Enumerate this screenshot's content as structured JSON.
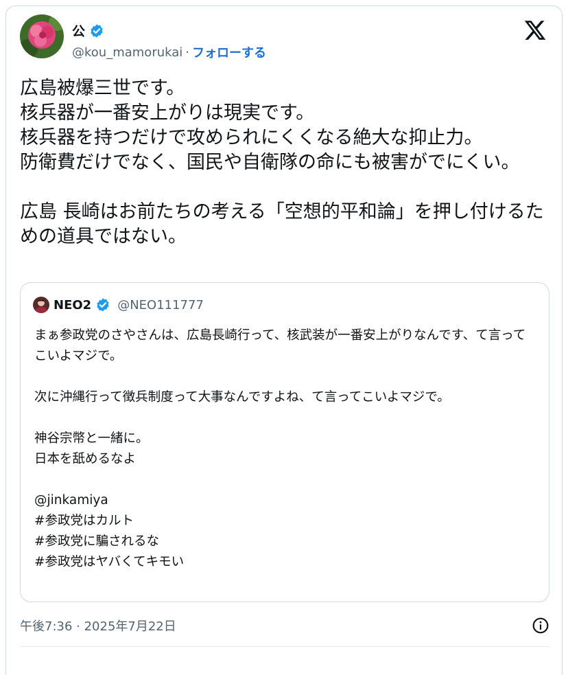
{
  "author": {
    "display_name": "公",
    "handle": "@kou_mamorukai",
    "separator": "·",
    "follow_label": "フォローする"
  },
  "tweet": {
    "text": "広島被爆三世です。\n核兵器が一番安上がりは現実です。\n核兵器を持つだけで攻められにくくなる絶大な抑止力。\n防衛費だけでなく、国民や自衛隊の命にも被害がでにくい。\n\n広島 長崎はお前たちの考える「空想的平和論」を押し付けるための道具ではない。",
    "timestamp": "午後7:36 · 2025年7月22日"
  },
  "quoted": {
    "display_name": "NEO2",
    "handle": "@NEO111777",
    "text": "まぁ参政党のさやさんは、広島長崎行って、核武装が一番安上がりなんです、て言ってこいよマジで。\n\n次に沖縄行って徴兵制度って大事なんですよね、て言ってこいよマジで。\n\n神谷宗幣と一緒に。\n日本を舐めるなよ\n\n@jinkamiya\n#参政党はカルト\n#参政党に騙されるな\n#参政党はヤバくてキモい"
  },
  "icons": {
    "verified": "verified-badge-icon",
    "x_logo": "x-logo-icon",
    "info": "info-icon"
  },
  "colors": {
    "verified_blue": "#1d9bf0",
    "follow_blue": "#1d6fd1",
    "secondary_text": "#536471"
  }
}
